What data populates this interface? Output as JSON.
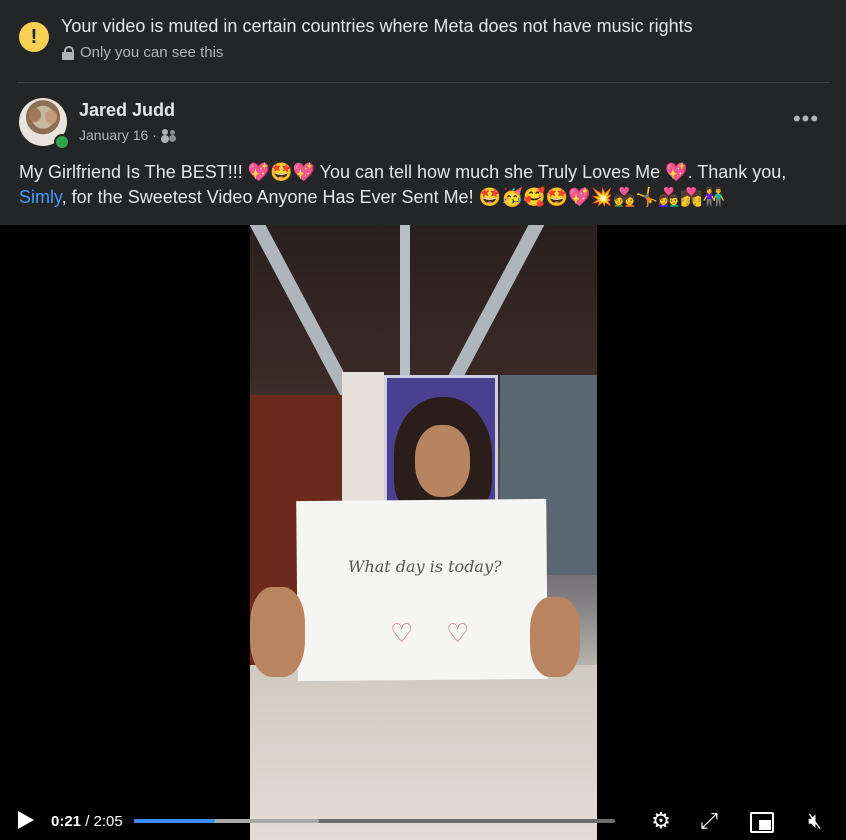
{
  "notice": {
    "title": "Your video is muted in certain countries where Meta does not have music rights",
    "subtitle": "Only you can see this"
  },
  "post": {
    "author": "Jared Judd",
    "date": "January 16",
    "separator": "·",
    "text_before_link": "My Girlfriend Is The BEST!!! 💖🤩💖 You can tell how much she Truly Loves Me 💖. Thank you,",
    "link": "Simly",
    "text_after_link": ", for the Sweetest Video Anyone Has Ever Sent Me! 🤩🥳🥰🤩💖💥💑🤸👩‍❤️‍👨💏👫",
    "more_label": "•••"
  },
  "video": {
    "paper_text": "What day is today?",
    "current_time": "0:21",
    "time_sep": " / ",
    "duration": "2:05",
    "progress_fraction": 0.168,
    "buffered_fraction": 0.385,
    "icons": {
      "play": "play-icon",
      "settings": "gear-icon",
      "fullscreen": "expand-icon",
      "pip": "picture-in-picture-icon",
      "mute": "speaker-muted-icon"
    }
  },
  "colors": {
    "background": "#242526",
    "link": "#4599ff",
    "progress": "#3b8ef8",
    "warning": "#f7d154",
    "online": "#31a24c"
  }
}
